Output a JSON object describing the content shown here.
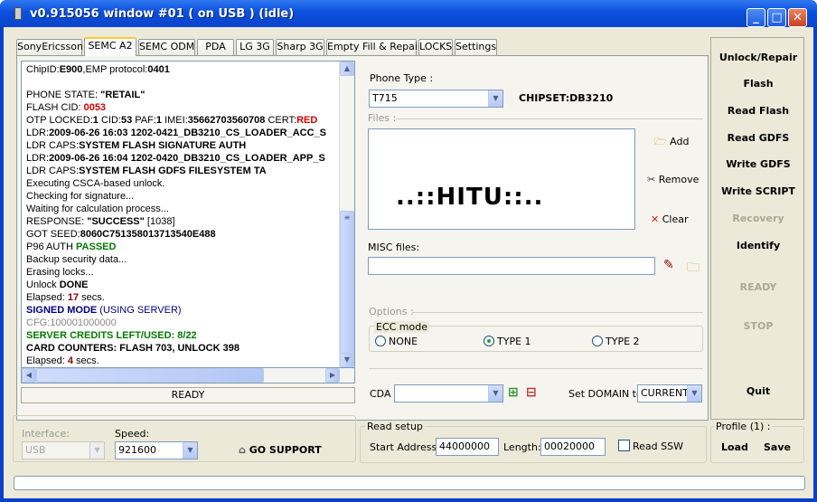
{
  "window": {
    "title": "v0.915056 window #01 ( on USB ) (idle)",
    "minimize": "_",
    "maximize": "□",
    "close": "✕"
  },
  "tabs": [
    "SonyEricsson",
    "SEMC A2",
    "SEMC ODM",
    "PDA",
    "LG 3G",
    "Sharp 3G",
    "Empty Fill & Repair",
    "LOCKS",
    "Settings"
  ],
  "active_tab": "SEMC A2",
  "log": [
    [
      {
        "t": "ChipID:"
      },
      {
        "t": "E900",
        "c": "b"
      },
      {
        "t": ",EMP protocol:"
      },
      {
        "t": "0401",
        "c": "b"
      }
    ],
    [],
    [
      {
        "t": "PHONE STATE: "
      },
      {
        "t": "\"RETAIL\"",
        "c": "b"
      }
    ],
    [
      {
        "t": "FLASH CID: "
      },
      {
        "t": "0053",
        "c": "red"
      }
    ],
    [
      {
        "t": "OTP LOCKED:"
      },
      {
        "t": "1",
        "c": "b"
      },
      {
        "t": " CID:"
      },
      {
        "t": "53",
        "c": "b"
      },
      {
        "t": " PAF:"
      },
      {
        "t": "1",
        "c": "b"
      },
      {
        "t": " IMEI:"
      },
      {
        "t": "35662703560708",
        "c": "b"
      },
      {
        "t": " CERT:"
      },
      {
        "t": "RED",
        "c": "red"
      }
    ],
    [
      {
        "t": "LDR:"
      },
      {
        "t": "2009-06-26 16:03 1202-0421_DB3210_CS_LOADER_ACC_S",
        "c": "b"
      }
    ],
    [
      {
        "t": "LDR CAPS:"
      },
      {
        "t": "SYSTEM FLASH SIGNATURE AUTH",
        "c": "b"
      }
    ],
    [
      {
        "t": "LDR:"
      },
      {
        "t": "2009-06-26 16:04 1202-0420_DB3210_CS_LOADER_APP_S",
        "c": "b"
      }
    ],
    [
      {
        "t": "LDR CAPS:"
      },
      {
        "t": "SYSTEM FLASH GDFS FILESYSTEM TA",
        "c": "b"
      }
    ],
    [
      {
        "t": "Executing CSCA-based unlock."
      }
    ],
    [
      {
        "t": "Checking for signature..."
      }
    ],
    [
      {
        "t": "Waiting for calculation process..."
      }
    ],
    [
      {
        "t": "RESPONSE: "
      },
      {
        "t": "\"SUCCESS\"",
        "c": "b"
      },
      {
        "t": " [1038]"
      }
    ],
    [
      {
        "t": "GOT SEED:"
      },
      {
        "t": "8060C751358013713540E488",
        "c": "b"
      }
    ],
    [
      {
        "t": "P96 AUTH "
      },
      {
        "t": "PASSED",
        "c": "green"
      }
    ],
    [
      {
        "t": "Backup security data..."
      }
    ],
    [
      {
        "t": "Erasing locks..."
      }
    ],
    [
      {
        "t": "Unlock "
      },
      {
        "t": "DONE",
        "c": "b"
      }
    ],
    [
      {
        "t": "Elapsed: "
      },
      {
        "t": "17",
        "c": "drk"
      },
      {
        "t": " secs."
      }
    ],
    [
      {
        "t": "SIGNED MODE",
        "c": "navy b"
      },
      {
        "t": " (USING SERVER)",
        "c": "navy"
      }
    ],
    [
      {
        "t": "CFG:",
        "c": "gray"
      },
      {
        "t": "10000",
        "c": "gray"
      },
      {
        "t": "1000000",
        "c": "gray"
      }
    ],
    [
      {
        "t": "SERVER CREDITS LEFT/USED: ",
        "c": "green"
      },
      {
        "t": "8/22",
        "c": "green"
      }
    ],
    [
      {
        "t": "CARD COUNTERS: FLASH ",
        "c": "b"
      },
      {
        "t": "703",
        "c": "b"
      },
      {
        "t": ", UNLOCK ",
        "c": "b"
      },
      {
        "t": "398",
        "c": "b"
      }
    ],
    [
      {
        "t": "Elapsed: "
      },
      {
        "t": "4",
        "c": "drk"
      },
      {
        "t": " secs."
      }
    ]
  ],
  "log_status": "READY",
  "phone": {
    "label": "Phone Type :",
    "value": "T715",
    "chipset": "CHIPSET:DB3210"
  },
  "files": {
    "label": "Files :",
    "content": "..::HITU::..",
    "add": "Add",
    "remove": "Remove",
    "clear": "Clear"
  },
  "misc": {
    "label": "MISC files:",
    "value": ""
  },
  "options": {
    "label": "Options :",
    "ecc_label": "ECC mode",
    "radios": [
      "NONE",
      "TYPE 1",
      "TYPE 2"
    ],
    "selected": "TYPE 1"
  },
  "cda": {
    "label": "CDA",
    "value": "",
    "domain_label": "Set DOMAIN to",
    "domain_value": "CURRENT"
  },
  "right": {
    "unlock": "Unlock/Repair",
    "flash": "Flash",
    "read_flash": "Read Flash",
    "read_gdfs": "Read GDFS",
    "write_gdfs": "Write GDFS",
    "write_script": "Write SCRIPT",
    "recovery": "Recovery",
    "identify": "Identify",
    "ready": "READY",
    "stop": "STOP",
    "quit": "Quit"
  },
  "bottom": {
    "interface_label": "Interface:",
    "interface_value": "USB",
    "speed_label": "Speed:",
    "speed_value": "921600",
    "go_support": "GO SUPPORT",
    "read_setup": "Read setup",
    "start_label": "Start Address:",
    "start_value": "44000000",
    "length_label": "Length:",
    "length_value": "00020000",
    "read_ssw": "Read SSW",
    "profile": "Profile (1) :",
    "load": "Load",
    "save": "Save"
  },
  "colors": {
    "title_bar": "#0b4fdc",
    "face": "#ece9d8",
    "accent_red": "#d00000",
    "accent_green": "#007a00"
  }
}
